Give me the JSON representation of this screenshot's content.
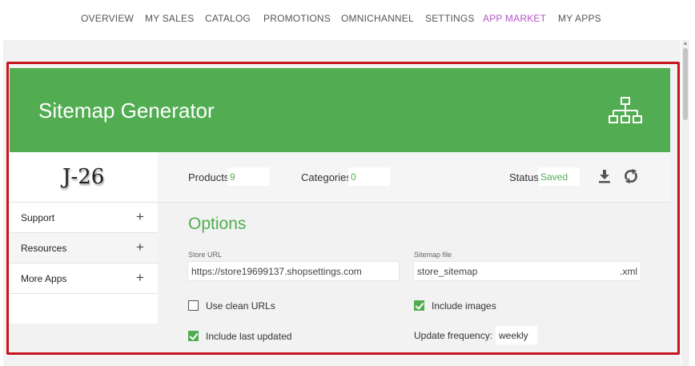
{
  "nav": {
    "items": [
      "OVERVIEW",
      "MY SALES",
      "CATALOG",
      "PROMOTIONS",
      "OMNICHANNEL",
      "SETTINGS",
      "APP MARKET",
      "MY APPS"
    ],
    "active": "APP MARKET",
    "active_color": "#b455c8"
  },
  "header": {
    "title": "Sitemap Generator",
    "color": "#52ad52",
    "icon": "sitemap-icon"
  },
  "sidebar": {
    "logo": "J-26",
    "items": [
      {
        "label": "Support",
        "icon": "plus-icon"
      },
      {
        "label": "Resources",
        "icon": "plus-icon"
      },
      {
        "label": "More Apps",
        "icon": "plus-icon"
      }
    ]
  },
  "stats": {
    "products_label": "Products:",
    "products_value": "9",
    "categories_label": "Categories:",
    "categories_value": "0",
    "status_label": "Status:",
    "status_value": "Saved",
    "download_icon": "download-icon",
    "refresh_icon": "refresh-icon"
  },
  "options": {
    "title": "Options",
    "store_url_label": "Store URL",
    "store_url_value": "https://store19699137.shopsettings.com",
    "sitemap_file_label": "Sitemap file",
    "sitemap_file_value": "store_sitemap",
    "sitemap_file_suffix": ".xml",
    "clean_urls_label": "Use clean URLs",
    "clean_urls_checked": false,
    "include_images_label": "Include images",
    "include_images_checked": true,
    "last_updated_label": "Include last updated",
    "last_updated_checked": true,
    "frequency_label": "Update frequency:",
    "frequency_value": "weekly"
  },
  "highlight_color": "#c8141e"
}
